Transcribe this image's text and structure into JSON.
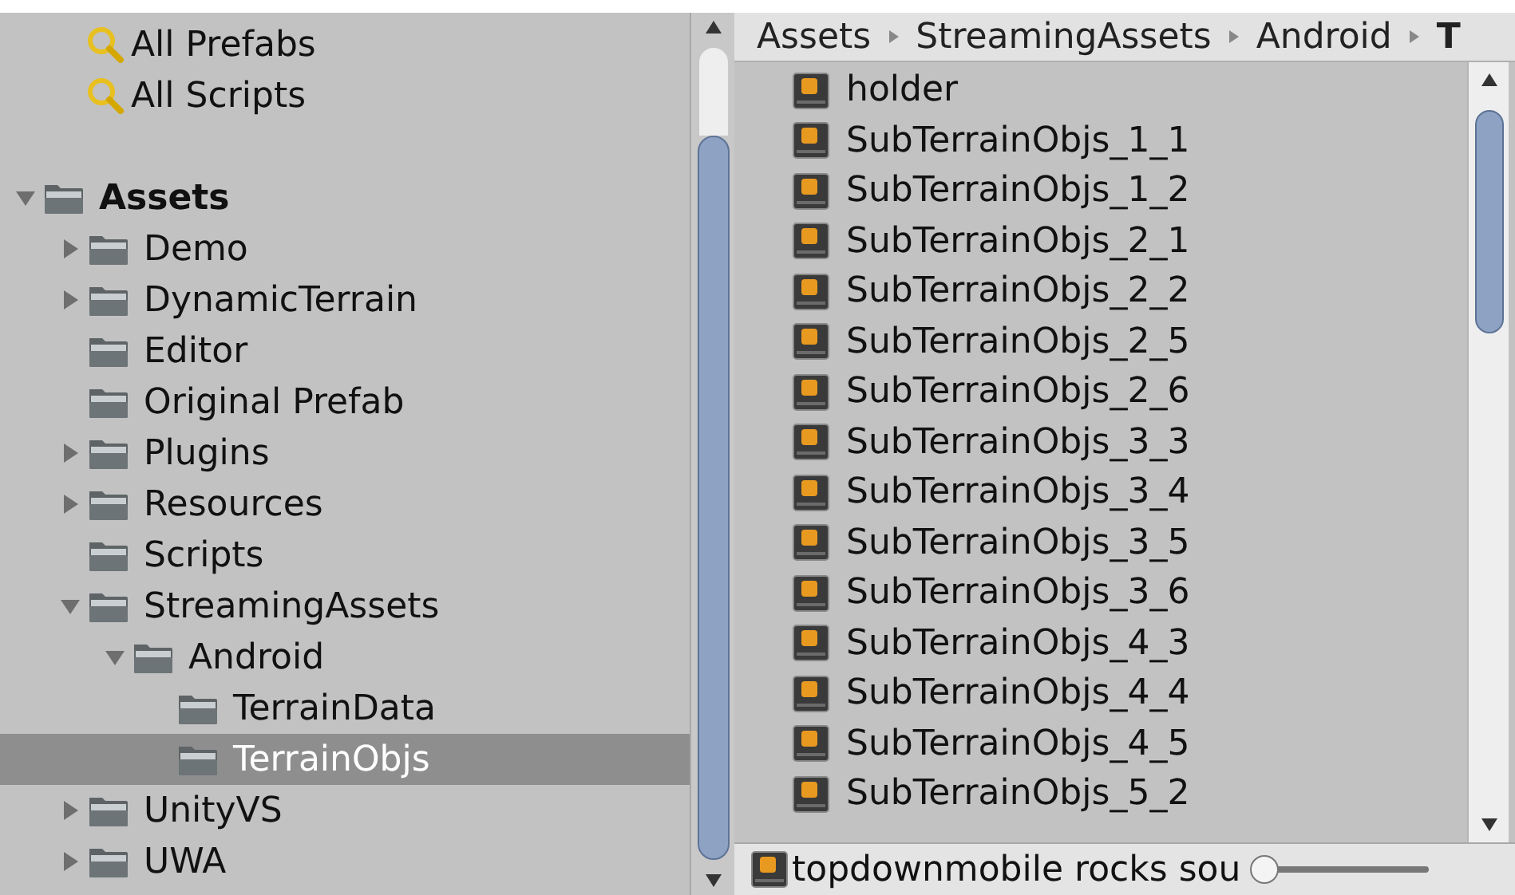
{
  "search_items": [
    {
      "label": "All Prefabs"
    },
    {
      "label": "All Scripts"
    }
  ],
  "tree": [
    {
      "label": "Assets",
      "expanded": true,
      "selected": false,
      "children": [
        {
          "label": "Demo",
          "expanded": false,
          "selected": false
        },
        {
          "label": "DynamicTerrain",
          "expanded": false,
          "selected": false
        },
        {
          "label": "Editor",
          "selected": false
        },
        {
          "label": "Original Prefab",
          "selected": false
        },
        {
          "label": "Plugins",
          "expanded": false,
          "selected": false
        },
        {
          "label": "Resources",
          "expanded": false,
          "selected": false
        },
        {
          "label": "Scripts",
          "selected": false
        },
        {
          "label": "StreamingAssets",
          "expanded": true,
          "selected": false,
          "children": [
            {
              "label": "Android",
              "expanded": true,
              "selected": false,
              "children": [
                {
                  "label": "TerrainData",
                  "selected": false
                },
                {
                  "label": "TerrainObjs",
                  "selected": true
                }
              ]
            }
          ]
        },
        {
          "label": "UnityVS",
          "expanded": false,
          "selected": false
        },
        {
          "label": "UWA",
          "expanded": false,
          "selected": false
        }
      ]
    }
  ],
  "breadcrumb": [
    "Assets",
    "StreamingAssets",
    "Android",
    "T"
  ],
  "files": [
    {
      "label": "holder"
    },
    {
      "label": "SubTerrainObjs_1_1"
    },
    {
      "label": "SubTerrainObjs_1_2"
    },
    {
      "label": "SubTerrainObjs_2_1"
    },
    {
      "label": "SubTerrainObjs_2_2"
    },
    {
      "label": "SubTerrainObjs_2_5"
    },
    {
      "label": "SubTerrainObjs_2_6"
    },
    {
      "label": "SubTerrainObjs_3_3"
    },
    {
      "label": "SubTerrainObjs_3_4"
    },
    {
      "label": "SubTerrainObjs_3_5"
    },
    {
      "label": "SubTerrainObjs_3_6"
    },
    {
      "label": "SubTerrainObjs_4_3"
    },
    {
      "label": "SubTerrainObjs_4_4"
    },
    {
      "label": "SubTerrainObjs_4_5"
    },
    {
      "label": "SubTerrainObjs_5_2"
    }
  ],
  "footer": {
    "label": "topdownmobile rocks sou",
    "zoom_slider": {
      "level": 0
    }
  }
}
